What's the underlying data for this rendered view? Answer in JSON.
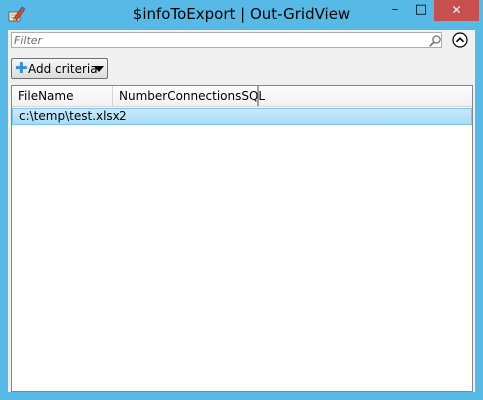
{
  "window": {
    "title": "$infoToExport | Out-GridView",
    "minimize_glyph": "–",
    "maximize_glyph": "□",
    "close_glyph": "✕",
    "frame_color": "#57b9e5",
    "close_color": "#c7504f"
  },
  "filter": {
    "placeholder": "Filter",
    "value": "",
    "search_icon": "search-icon",
    "collapse_icon": "chevron-up-circle-icon"
  },
  "criteria": {
    "label": "Add criteria",
    "icon": "plus-icon"
  },
  "grid": {
    "columns": [
      "FileName",
      "NumberConnectionsSQL"
    ],
    "rows": [
      {
        "FileName": "c:\\temp\\test.xlsx",
        "NumberConnectionsSQL": "2",
        "selected": true
      }
    ],
    "selection_color": "#a8dcf6"
  }
}
